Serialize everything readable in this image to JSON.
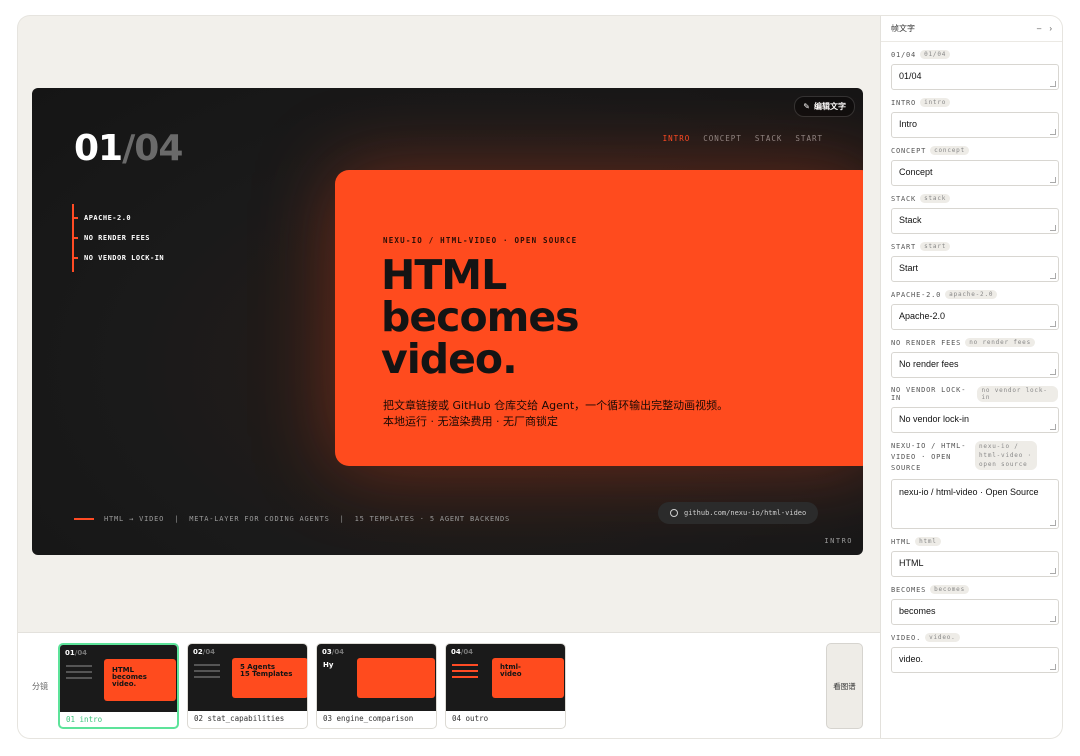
{
  "video": {
    "edit_button": "编辑文字",
    "counter_current": "01",
    "counter_sep": "/",
    "counter_total": "04",
    "nav": [
      "INTRO",
      "CONCEPT",
      "STACK",
      "START"
    ],
    "features": [
      "APACHE-2.0",
      "NO RENDER FEES",
      "NO VENDOR LOCK-IN"
    ],
    "kicker": "NEXU-IO / HTML-VIDEO · OPEN SOURCE",
    "headline": [
      "HTML",
      "becomes",
      "video."
    ],
    "zh_line1": "把文章链接或 GitHub 仓库交给 Agent，一个循环输出完整动画视频。",
    "zh_line2": "本地运行 · 无渲染费用 · 无厂商锁定",
    "footer": [
      "HTML → VIDEO",
      "|",
      "META-LAYER FOR CODING AGENTS",
      "|",
      "15 TEMPLATES · 5 AGENT BACKENDS"
    ],
    "github": "github.com/nexu-io/html-video",
    "corner_tag": "INTRO",
    "accent": "#ff4b24"
  },
  "strip": {
    "label": "分镜",
    "view_button": "看图谱",
    "thumbs": [
      {
        "num": "01",
        "total": "04",
        "caption": "01 intro",
        "text": [
          "HTML",
          "becomes",
          "video."
        ]
      },
      {
        "num": "02",
        "total": "04",
        "caption": "02 stat_capabilities",
        "text": [
          "5 Agents",
          "15 Templates"
        ]
      },
      {
        "num": "03",
        "total": "04",
        "caption": "03 engine_comparison",
        "text": [
          "Hy"
        ]
      },
      {
        "num": "04",
        "total": "04",
        "caption": "04 outro",
        "text": [
          "html-",
          "video"
        ]
      }
    ]
  },
  "side": {
    "title": "帧文字",
    "minimize": "–",
    "close": "›",
    "fields": [
      {
        "label": "01/04",
        "tag": "01/04",
        "value": "01/04"
      },
      {
        "label": "INTRO",
        "tag": "intro",
        "value": "Intro"
      },
      {
        "label": "CONCEPT",
        "tag": "concept",
        "value": "Concept"
      },
      {
        "label": "STACK",
        "tag": "stack",
        "value": "Stack"
      },
      {
        "label": "START",
        "tag": "start",
        "value": "Start"
      },
      {
        "label": "APACHE-2.0",
        "tag": "apache-2.0",
        "value": "Apache-2.0"
      },
      {
        "label": "NO RENDER FEES",
        "tag": "no render fees",
        "value": "No render fees"
      },
      {
        "label": "NO VENDOR LOCK-IN",
        "tag": "no vendor lock-in",
        "value": "No vendor lock-in"
      },
      {
        "label": "NEXU-IO / HTML-VIDEO · OPEN SOURCE",
        "tag": "nexu-io / html-video · open source",
        "value": "nexu-io / html-video · Open Source"
      },
      {
        "label": "HTML",
        "tag": "html",
        "value": "HTML"
      },
      {
        "label": "BECOMES",
        "tag": "becomes",
        "value": "becomes"
      },
      {
        "label": "VIDEO.",
        "tag": "video.",
        "value": "video."
      }
    ]
  }
}
